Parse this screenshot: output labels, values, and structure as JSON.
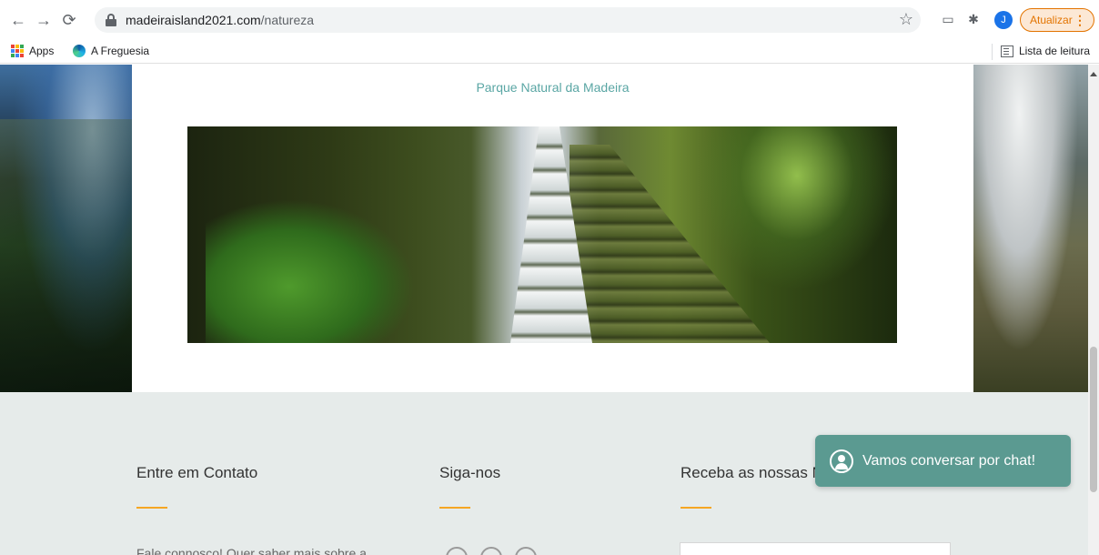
{
  "browser": {
    "url_host": "madeiraisland2021.com",
    "url_path": "/natureza",
    "avatar_initial": "J",
    "update_label": "Atualizar",
    "update_menu": "⋮",
    "bookmarks": [
      {
        "label": "Apps",
        "icon": "apps-grid-icon"
      },
      {
        "label": "A Freguesia",
        "icon": "edge-icon"
      }
    ],
    "reading_list": "Lista de leitura",
    "apps_colors": [
      "#ea4335",
      "#fbbc04",
      "#34a853",
      "#4285f4",
      "#ea4335",
      "#fbbc04",
      "#34a853",
      "#4285f4",
      "#ea4335"
    ]
  },
  "page": {
    "park_title": "Parque Natural da Madeira",
    "hero_alt": "",
    "footer": {
      "contact_title": "Entre em Contato",
      "contact_text": "Fale connosco! Quer saber mais sobre a",
      "follow_title": "Siga-nos",
      "news_title": "Receba as nossas Novidades",
      "email_placeholder": "",
      "accent_color": "#f5a623"
    },
    "chat_label": "Vamos conversar por chat!"
  }
}
